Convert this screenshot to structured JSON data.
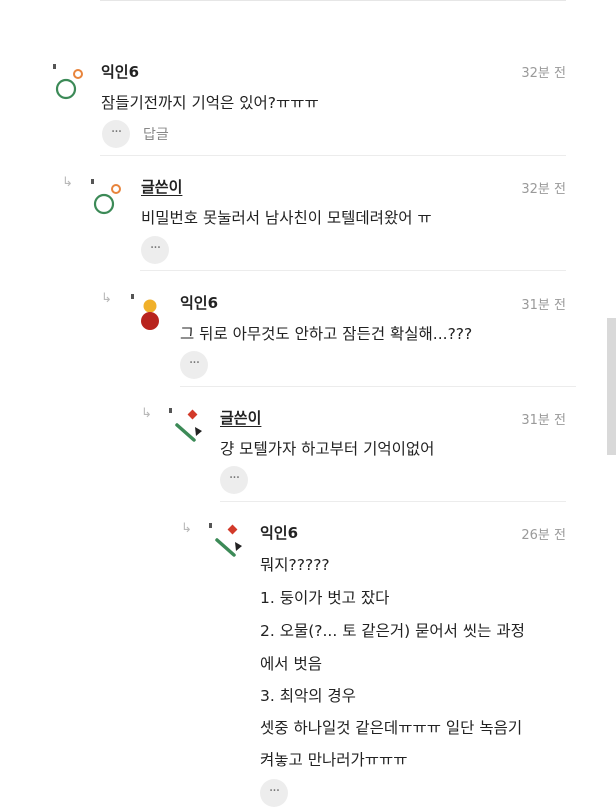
{
  "comments": [
    {
      "name": "익인6",
      "time": "32분 전",
      "lines": [
        "잠들기전까지 기억은 있어?ㅠㅠㅠ"
      ],
      "more": "···",
      "reply_label": "답글"
    },
    {
      "name": "글쓴이",
      "time": "32분 전",
      "lines": [
        "비밀번호 못눌러서 남사친이 모텔데려왔어 ㅠ"
      ],
      "more": "···"
    },
    {
      "name": "익인6",
      "time": "31분 전",
      "lines": [
        "그 뒤로 아무것도 안하고 잠든건 확실해...???"
      ],
      "more": "···"
    },
    {
      "name": "글쓴이",
      "time": "31분 전",
      "lines": [
        "걍 모텔가자 하고부터 기억이없어"
      ],
      "more": "···"
    },
    {
      "name": "익인6",
      "time": "26분 전",
      "lines": [
        "뭐지?????",
        "1. 둥이가 벗고 잤다",
        "2. 오물(?... 토 같은거) 묻어서 씻는 과정",
        "에서 벗음",
        "3. 최악의 경우",
        "셋중 하나일것 같은데ㅠㅠㅠ 일단 녹음기",
        "켜놓고 만나러가ㅠㅠㅠ"
      ],
      "more": "···"
    }
  ],
  "icons": {
    "reply_arrow": "reply-arrow-icon",
    "more": "more-dots-icon"
  },
  "colors": {
    "orange": "#e8843c",
    "green": "#3c8a57",
    "yellow": "#f0b02a",
    "red": "#b8231d",
    "diamond_red": "#d23a2a",
    "text": "#222222",
    "muted": "#9a9a9a"
  }
}
